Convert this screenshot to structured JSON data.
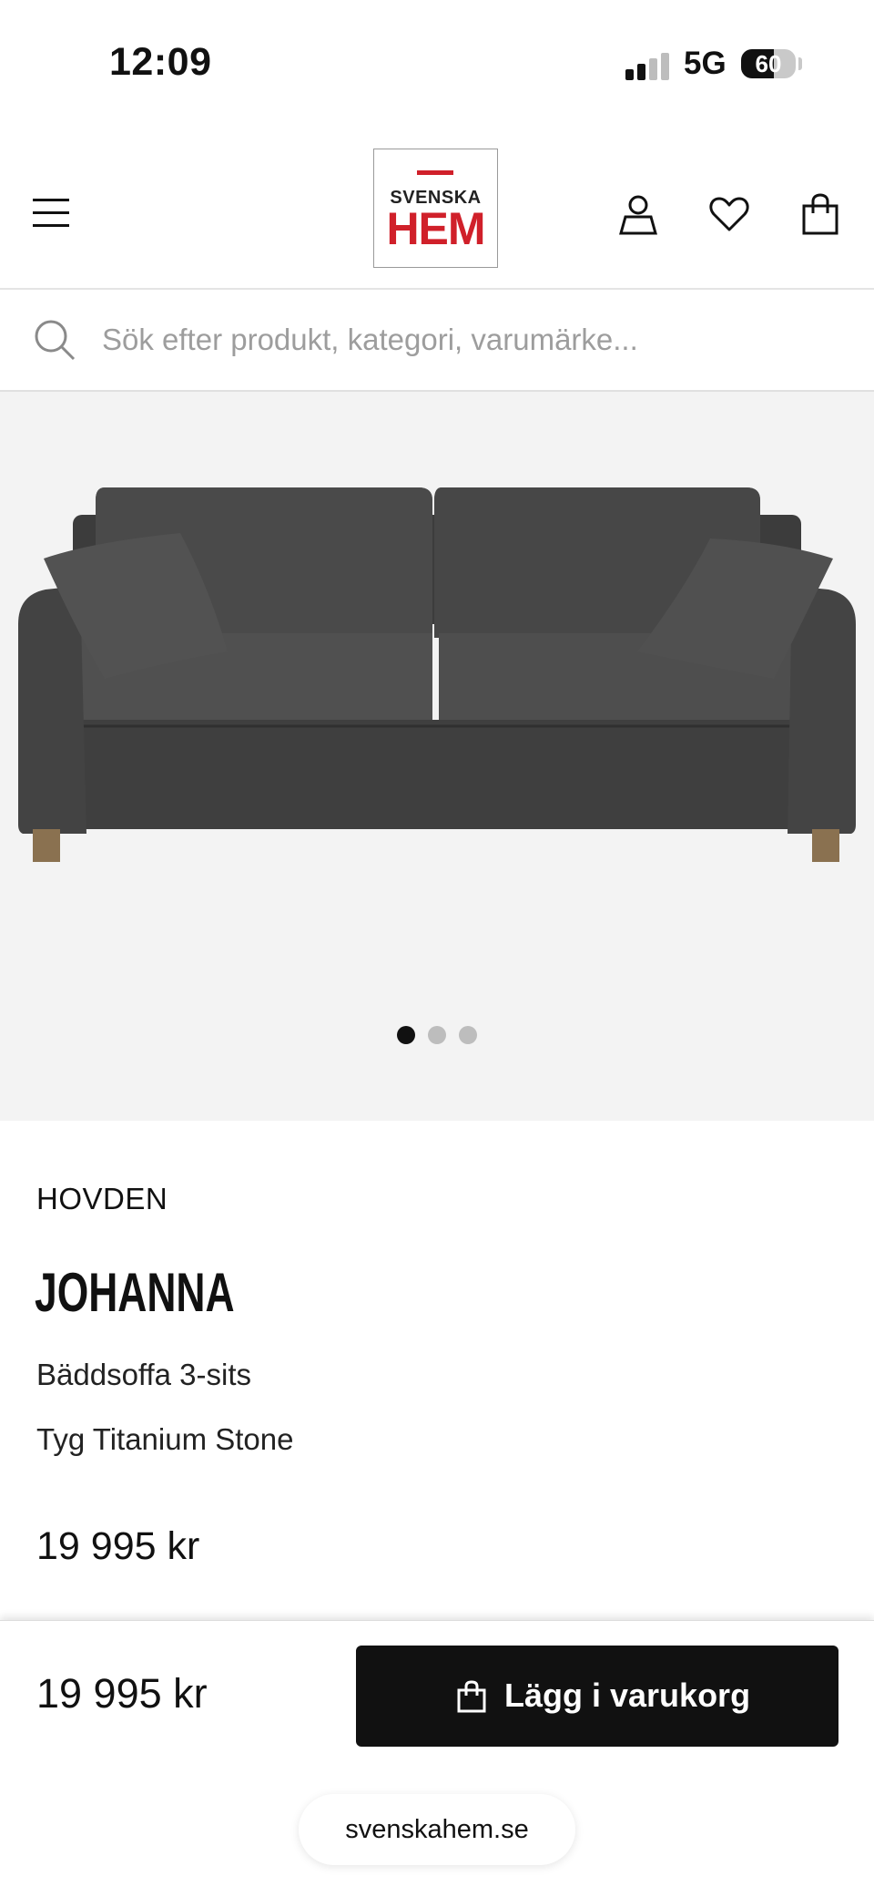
{
  "status_bar": {
    "time": "12:09",
    "network": "5G",
    "battery_percent": "60",
    "battery_level": 0.6
  },
  "header": {
    "logo_line1": "SVENSKA",
    "logo_line2": "HEM",
    "brand_color": "#d0202a"
  },
  "search": {
    "placeholder": "Sök efter produkt, kategori, varumärke...",
    "value": ""
  },
  "gallery": {
    "image_count": 3,
    "active_index": 0,
    "dot_active_color": "#111111",
    "dot_inactive_color": "#bdbdbd"
  },
  "product": {
    "brand": "HOVDEN",
    "name": "JOHANNA",
    "type": "Bäddsoffa 3-sits",
    "variant": "Tyg Titanium Stone",
    "price": "19 995 kr"
  },
  "sticky_bar": {
    "price": "19 995 kr",
    "add_to_cart_label": "Lägg i varukorg"
  },
  "browser": {
    "url": "svenskahem.se"
  }
}
